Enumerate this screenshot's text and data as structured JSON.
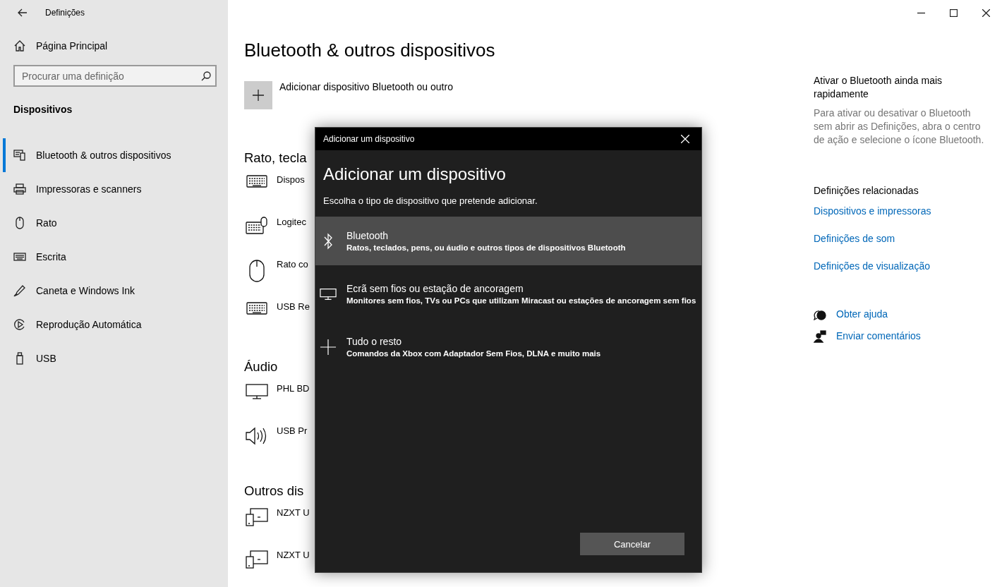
{
  "window": {
    "title": "Definições"
  },
  "sidebar": {
    "home": "Página Principal",
    "search": {
      "placeholder": "Procurar uma definição"
    },
    "heading": "Dispositivos",
    "items": [
      {
        "label": "Bluetooth & outros dispositivos",
        "kind": "bluetooth",
        "selected": true
      },
      {
        "label": "Impressoras e scanners",
        "kind": "printer",
        "selected": false
      },
      {
        "label": "Rato",
        "kind": "mouse",
        "selected": false
      },
      {
        "label": "Escrita",
        "kind": "keyboard",
        "selected": false
      },
      {
        "label": "Caneta e Windows Ink",
        "kind": "pen",
        "selected": false
      },
      {
        "label": "Reprodução Automática",
        "kind": "autoplay",
        "selected": false
      },
      {
        "label": "USB",
        "kind": "usb",
        "selected": false
      }
    ]
  },
  "main": {
    "title": "Bluetooth & outros dispositivos",
    "add_button": "Adicionar dispositivo Bluetooth ou outro",
    "sections": [
      {
        "heading": "Rato, tecla",
        "devices": [
          {
            "name": "Dispos",
            "kind": "keyboard"
          },
          {
            "name": "Logitec",
            "kind": "keyboard-mouse"
          },
          {
            "name": "Rato co",
            "kind": "mouse"
          },
          {
            "name": "USB Re",
            "kind": "keyboard"
          }
        ]
      },
      {
        "heading": "Áudio",
        "devices": [
          {
            "name": "PHL BD",
            "kind": "monitor"
          },
          {
            "name": "USB Pr",
            "kind": "speaker"
          }
        ]
      },
      {
        "heading": "Outros dis",
        "devices": [
          {
            "name": "NZXT U",
            "kind": "device"
          },
          {
            "name": "NZXT U",
            "kind": "device"
          }
        ]
      }
    ]
  },
  "aside": {
    "tip_heading": "Ativar o Bluetooth ainda mais rapidamente",
    "tip_text": "Para ativar ou desativar o Bluetooth sem abrir as Definições, abra o centro de ação e selecione o ícone Bluetooth.",
    "related_heading": "Definições relacionadas",
    "related_links": [
      "Dispositivos e impressoras",
      "Definições de som",
      "Definições de visualização"
    ],
    "help": [
      {
        "label": "Obter ajuda",
        "kind": "help"
      },
      {
        "label": "Enviar comentários",
        "kind": "feedback"
      }
    ]
  },
  "dialog": {
    "title": "Adicionar um dispositivo",
    "heading": "Adicionar um dispositivo",
    "subtitle": "Escolha o tipo de dispositivo que pretende adicionar.",
    "options": [
      {
        "title": "Bluetooth",
        "description": "Ratos, teclados, pens, ou áudio e outros tipos de dispositivos Bluetooth",
        "kind": "bluetooth",
        "selected": true
      },
      {
        "title": "Ecrã sem fios ou estação de ancoragem",
        "description": "Monitores sem fios, TVs ou PCs que utilizam Miracast ou estações de ancoragem sem fios",
        "kind": "display",
        "selected": false
      },
      {
        "title": "Tudo o resto",
        "description": "Comandos da Xbox com Adaptador Sem Fios, DLNA e muito mais",
        "kind": "other",
        "selected": false
      }
    ],
    "cancel": "Cancelar"
  }
}
